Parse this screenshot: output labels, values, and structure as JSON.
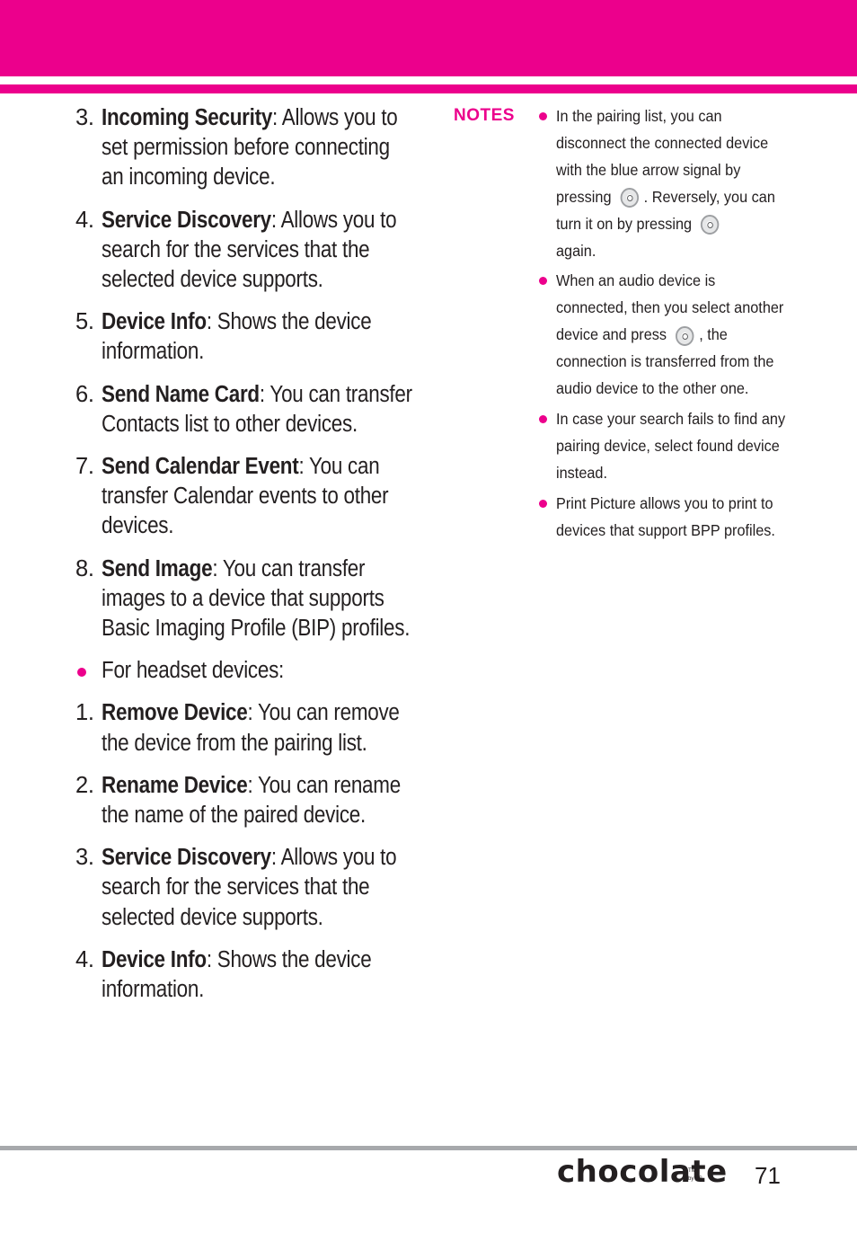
{
  "colors": {
    "accent": "#ec008c",
    "rule": "#a7a9ac",
    "text": "#231f20"
  },
  "left_items": [
    {
      "marker": "3.",
      "term": "Incoming Security",
      "desc": ": Allows you to set permission before connecting an incoming device."
    },
    {
      "marker": "4.",
      "term": "Service Discovery",
      "desc": ": Allows you to search for the services that the selected device supports."
    },
    {
      "marker": "5.",
      "term": "Device Info",
      "desc": ": Shows the device information."
    },
    {
      "marker": "6.",
      "term": "Send Name Card",
      "desc": ": You can transfer Contacts list to other devices."
    },
    {
      "marker": "7.",
      "term": "Send Calendar Event",
      "desc": ": You can transfer Calendar events to other devices."
    },
    {
      "marker": "8.",
      "term": "Send Image",
      "desc": ": You can transfer images to a device that supports Basic Imaging Profile (BIP) profiles."
    },
    {
      "marker": "bullet",
      "term": "",
      "desc": "For headset devices:"
    },
    {
      "marker": "1.",
      "term": "Remove Device",
      "desc": ": You can remove the device from the pairing list."
    },
    {
      "marker": "2.",
      "term": "Rename Device",
      "desc": ": You can rename the name of the paired device."
    },
    {
      "marker": "3.",
      "term": "Service Discovery",
      "desc": ": Allows you to search for the services that the selected device supports."
    },
    {
      "marker": "4.",
      "term": "Device Info",
      "desc": ": Shows the device information."
    }
  ],
  "notes": {
    "label": "NOTES",
    "items": [
      {
        "parts": [
          "In the pairing list, you can disconnect the connected device with the blue arrow signal by pressing",
          ". Reversely, you can turn it on by pressing",
          "again."
        ],
        "icon": "ok-key-icon"
      },
      {
        "parts": [
          "When an audio device is connected, then you select another device and press",
          ", the connection is transferred from the audio device to the other one."
        ],
        "icon": "ok-key-icon"
      },
      {
        "parts": [
          "In case your search fails to find any pairing device, select found device instead."
        ]
      },
      {
        "parts": [
          "Print Picture allows you to print to devices that support BPP profiles."
        ]
      }
    ]
  },
  "footer": {
    "brand": "chocolate",
    "brand_tm": "TM",
    "brand_by": "by LG",
    "page_number": "71"
  }
}
